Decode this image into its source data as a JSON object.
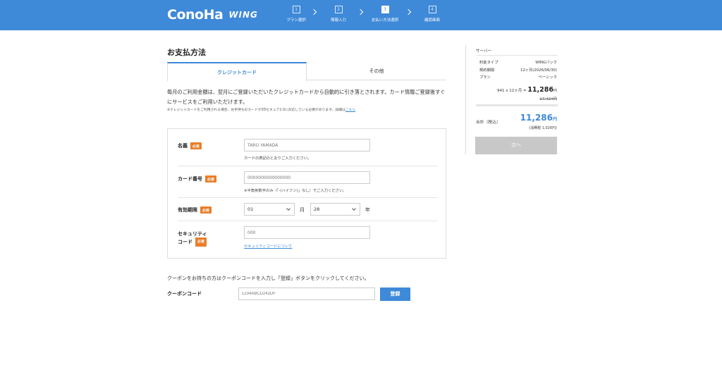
{
  "header": {
    "brand": "ConoHa",
    "product": "WING",
    "steps": [
      {
        "num": "1",
        "label": "プラン選択"
      },
      {
        "num": "2",
        "label": "情報入力"
      },
      {
        "num": "3",
        "label": "支払い方法選択"
      },
      {
        "num": "4",
        "label": "確認画面"
      }
    ],
    "active_step": 3
  },
  "main": {
    "title": "お支払方法",
    "tabs": [
      {
        "label": "クレジットカード",
        "active": true
      },
      {
        "label": "その他",
        "active": false
      }
    ],
    "description": "毎月のご利用金額は、翌月にご登録いただいたクレジットカードから自動的に引き落とされます。カード情報ご登録後すぐにサービスをご利用いただけます。",
    "note": "※クレジットカードをご利用される場合、お手持ちのカードが3Dセキュア2.0に対応している必要があります。詳細は",
    "note_link": "こちら",
    "form": {
      "required_badge": "必須",
      "name": {
        "label": "名義",
        "placeholder": "TARO YAMADA",
        "hint": "カードの表記のとおりご入力ください。"
      },
      "card_number": {
        "label": "カード番号",
        "placeholder": "0000000000000000",
        "hint": "※半角英数字のみ（「-(ハイフン)」なし）でご入力ください。"
      },
      "expiry": {
        "label": "有効期限",
        "month": "01",
        "month_unit": "月",
        "year": "28",
        "year_unit": "年"
      },
      "security": {
        "label_line1": "セキュリティ",
        "label_line2": "コード",
        "placeholder": "000",
        "link": "セキュリティコードについて"
      }
    },
    "coupon": {
      "text": "クーポンをお持ちの方はクーポンコードを入力し「登録」ボタンをクリックしてください。",
      "label": "クーポンコード",
      "placeholder": "1234ABCD242DF",
      "button": "登録"
    }
  },
  "sidebar": {
    "title": "サーバー",
    "rows": [
      {
        "k": "料金タイプ",
        "v": "WINGパック"
      },
      {
        "k": "契約期間",
        "v": "12ヶ月(2026/06/30)"
      },
      {
        "k": "プラン",
        "v": "ベーシック"
      }
    ],
    "unit_price": "941 x 12ヶ月 =",
    "subtotal": "11,286",
    "yen": "円",
    "original_price": "17,424円",
    "total_label": "合計（税込）",
    "total": "11,286",
    "tax_note": "(消費税 1,026円)",
    "next_button": "次へ"
  },
  "colors": {
    "brand": "#3e89d8",
    "required": "#e87f2c",
    "disabled": "#c8c8c8"
  }
}
